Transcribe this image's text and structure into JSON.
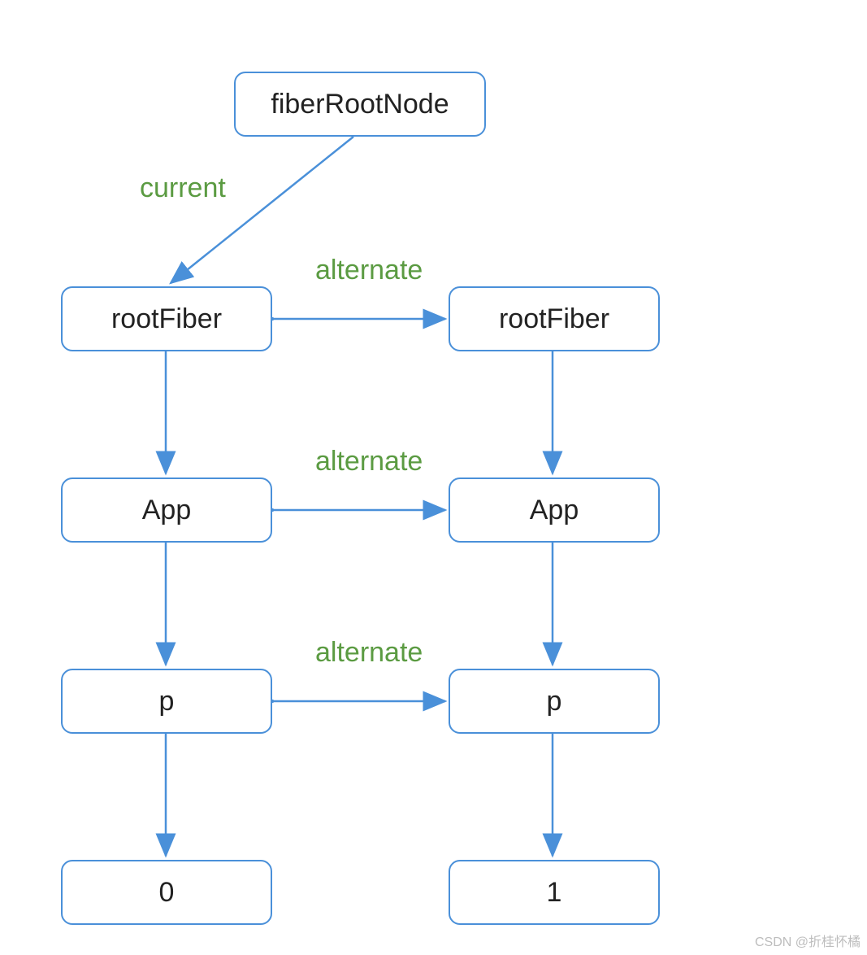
{
  "nodes": {
    "fiberRootNode": "fiberRootNode",
    "rootFiberLeft": "rootFiber",
    "rootFiberRight": "rootFiber",
    "appLeft": "App",
    "appRight": "App",
    "pLeft": "p",
    "pRight": "p",
    "zero": "0",
    "one": "1"
  },
  "labels": {
    "current": "current",
    "alternate1": "alternate",
    "alternate2": "alternate",
    "alternate3": "alternate"
  },
  "colors": {
    "nodeBorder": "#4a90d9",
    "arrow": "#4a90d9",
    "labelText": "#5b9b42",
    "watermark": "#bdbdbd"
  },
  "watermark": "CSDN @折桂怀橘"
}
